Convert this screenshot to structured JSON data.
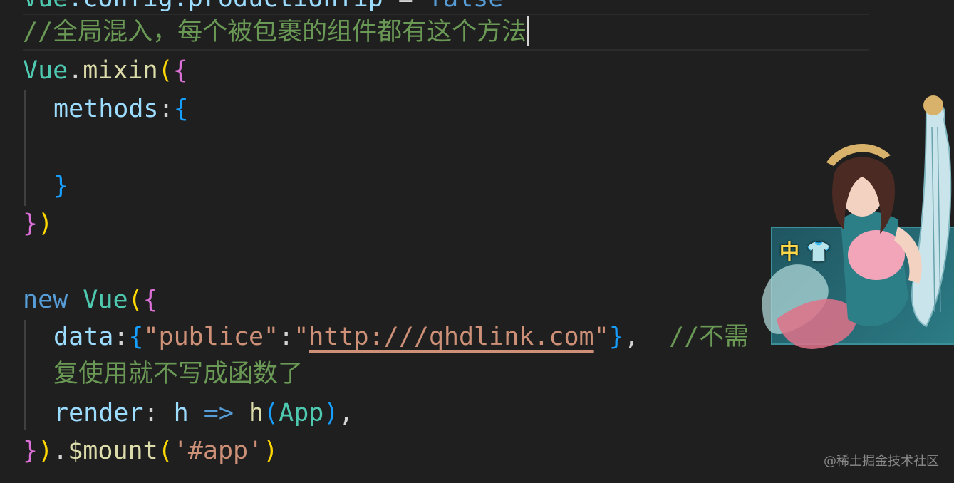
{
  "editor": {
    "line_top_partial": {
      "vue": "Vue",
      "config": ".config.productionTip",
      "eq": " = ",
      "val": "false"
    },
    "line_comment_mixin": {
      "text": "//全局混入，每个被包裹的组件都有这个方法"
    },
    "line_mixin": {
      "obj": "Vue",
      "dot": ".",
      "method": "mixin",
      "open_paren": "(",
      "open_brace": "{"
    },
    "line_methods": {
      "key": "methods",
      "colon": ":",
      "open_brace": "{"
    },
    "line_close_methods": {
      "close_brace": "}"
    },
    "line_close_mixin": {
      "close_brace": "}",
      "close_paren": ")"
    },
    "line_new_vue": {
      "kw": "new",
      "cls": "Vue",
      "open_paren": "(",
      "open_brace": "{"
    },
    "line_data": {
      "key": "data",
      "colon": ":",
      "open_brace": "{",
      "str_key": "\"publice\"",
      "sep": ":",
      "q1": "\"",
      "url": "http:///qhdlink.com",
      "q2": "\"",
      "close_brace": "}",
      "comma": ",",
      "comment_visible": "//不需"
    },
    "line_data_wrap": {
      "text": "复使用就不写成函数了"
    },
    "line_render": {
      "key": "render",
      "colon": ": ",
      "param": "h",
      "arrow": " => ",
      "fn": "h",
      "open_paren": "(",
      "arg": "App",
      "close_paren": ")",
      "comma": ","
    },
    "line_mount": {
      "close_brace": "}",
      "close_paren": ")",
      "dot": ".",
      "method": "$mount",
      "open_paren": "(",
      "arg": "'#app'",
      "close_paren2": ")"
    }
  },
  "overlay": {
    "badge_text": "中",
    "icon": "shirt-icon"
  },
  "watermark": "@稀土掘金技术社区",
  "colors": {
    "background": "#1f1f1f",
    "keyword": "#569cd6",
    "class": "#4ec9b0",
    "function": "#dcdcaa",
    "property": "#9cdcfe",
    "string": "#ce9178",
    "comment": "#6a9955",
    "bracket_gold": "#ffd700",
    "bracket_orchid": "#da70d6",
    "bracket_blue": "#179fff"
  }
}
